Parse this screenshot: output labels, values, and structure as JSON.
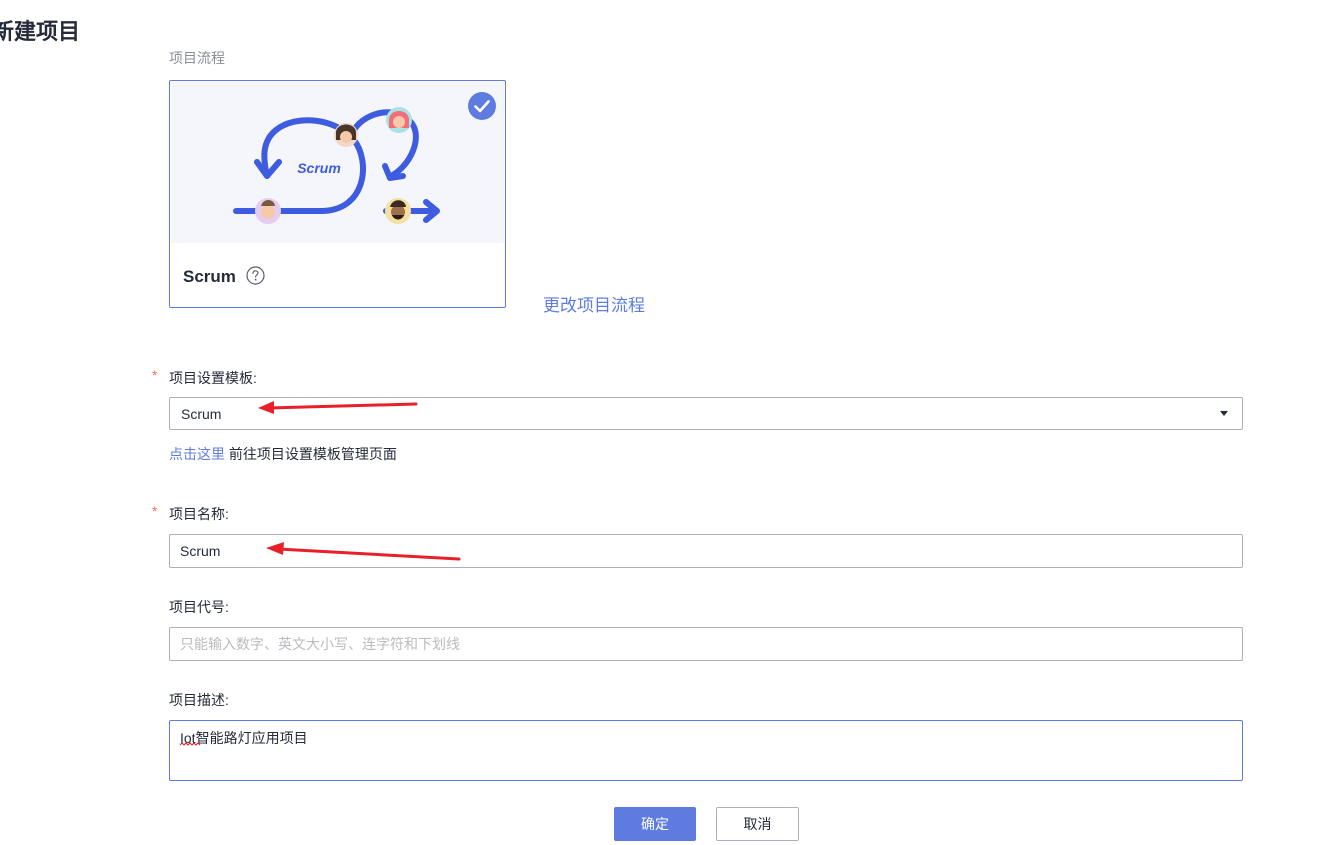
{
  "page": {
    "title": "新建项目"
  },
  "flow": {
    "section_label": "项目流程",
    "card_name": "Scrum",
    "illustration_text": "Scrum",
    "change_link": "更改项目流程"
  },
  "form": {
    "required_mark": "*",
    "template": {
      "label": "项目设置模板:",
      "value": "Scrum",
      "hint_link": "点击这里",
      "hint_text": "前往项目设置模板管理页面"
    },
    "name": {
      "label": "项目名称:",
      "value": "Scrum"
    },
    "code": {
      "label": "项目代号:",
      "value": "",
      "placeholder": "只能输入数字、英文大小写、连字符和下划线"
    },
    "description": {
      "label": "项目描述:",
      "value": "Iot智能路灯应用项目"
    }
  },
  "actions": {
    "confirm": "确定",
    "cancel": "取消"
  },
  "colors": {
    "brand": "#5e7ce0",
    "required": "#f66f6a",
    "annotation_arrow": "#e8202a",
    "text": "#252b3a",
    "placeholder": "#babbc0"
  },
  "icons": {
    "check": "check-circle-icon",
    "help": "help-circle-icon",
    "dropdown": "caret-down-icon"
  }
}
